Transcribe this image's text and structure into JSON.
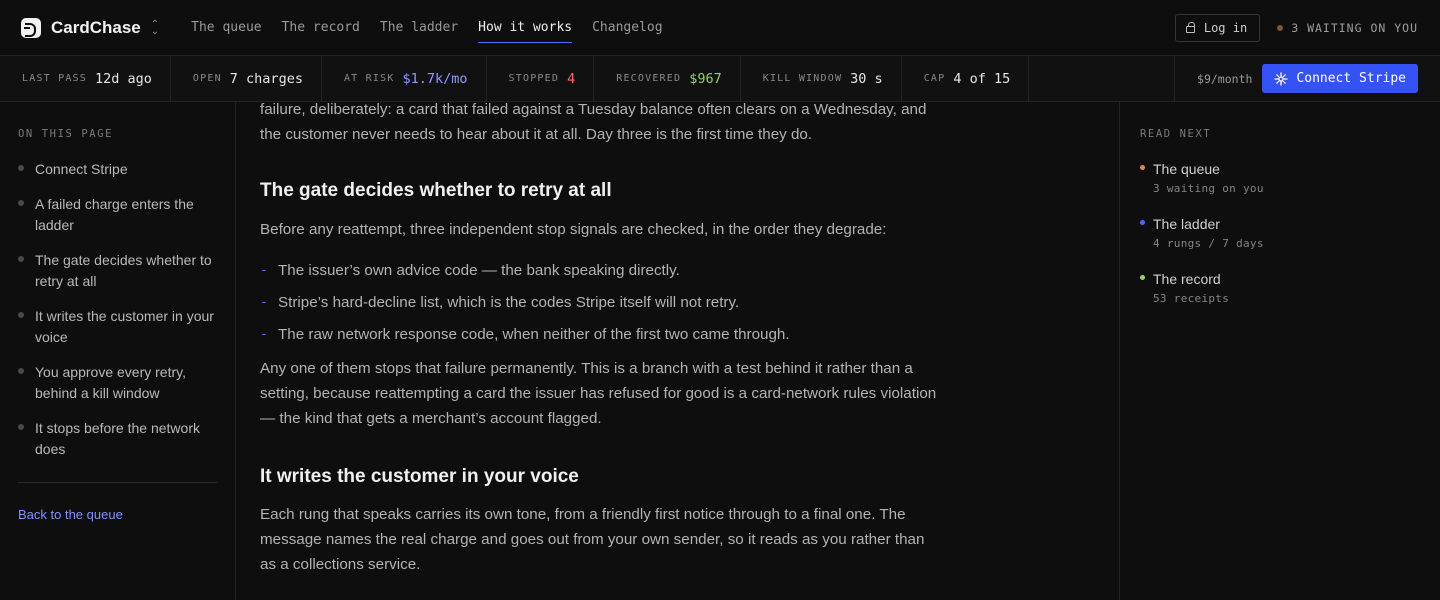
{
  "brand": {
    "name": "CardChase"
  },
  "nav": {
    "links": [
      "The queue",
      "The record",
      "The ladder",
      "How it works",
      "Changelog"
    ],
    "active_index": 3,
    "login_label": "Log in",
    "waiting_label": "3 WAITING ON YOU"
  },
  "stats": [
    {
      "label": "LAST PASS",
      "value": "12d ago",
      "tone": "default"
    },
    {
      "label": "OPEN",
      "value": "7 charges",
      "tone": "default"
    },
    {
      "label": "AT RISK",
      "value": "$1.7k/mo",
      "tone": "blue"
    },
    {
      "label": "STOPPED",
      "value": "4",
      "tone": "red"
    },
    {
      "label": "RECOVERED",
      "value": "$967",
      "tone": "green"
    },
    {
      "label": "KILL WINDOW",
      "value": "30 s",
      "tone": "default"
    },
    {
      "label": "CAP",
      "value": "4 of 15",
      "tone": "default"
    }
  ],
  "plan": {
    "price": "$9/month",
    "connect_label": "Connect Stripe"
  },
  "toc": {
    "heading": "ON THIS PAGE",
    "items": [
      "Connect Stripe",
      "A failed charge enters the ladder",
      "The gate decides whether to retry at all",
      "It writes the customer in your voice",
      "You approve every retry, behind a kill window",
      "It stops before the network does"
    ],
    "back_link": "Back to the queue"
  },
  "article": {
    "intro": "failure, deliberately: a card that failed against a Tuesday balance often clears on a Wednesday, and the customer never needs to hear about it at all. Day three is the first time they do.",
    "gate_heading": "The gate decides whether to retry at all",
    "gate_para": "Before any reattempt, three independent stop signals are checked, in the order they degrade:",
    "gate_list": [
      "The issuer’s own advice code — the bank speaking directly.",
      "Stripe’s hard-decline list, which is the codes Stripe itself will not retry.",
      "The raw network response code, when neither of the first two came through."
    ],
    "any_para": "Any one of them stops that failure permanently. This is a branch with a test behind it rather than a setting, because reattempting a card the issuer has refused for good is a card-network rules violation — the kind that gets a merchant’s account flagged.",
    "voice_heading": "It writes the customer in your voice",
    "voice_para": "Each rung that speaks carries its own tone, from a friendly first notice through to a final one. The message names the real charge and goes out from your own sender, so it reads as you rather than as a collections service."
  },
  "read_next": {
    "heading": "READ NEXT",
    "items": [
      {
        "title": "The queue",
        "subtitle": "3 waiting on you",
        "color": "#e0884a"
      },
      {
        "title": "The ladder",
        "subtitle": "4 rungs / 7 days",
        "color": "#4a68ff"
      },
      {
        "title": "The record",
        "subtitle": "53 receipts",
        "color": "#8fd16a"
      }
    ]
  },
  "icons": {
    "brand": "cardchase-logo-icon",
    "switcher": "chevron-updown-icon",
    "login": "lock-icon",
    "connect": "stripe-spark-icon"
  }
}
